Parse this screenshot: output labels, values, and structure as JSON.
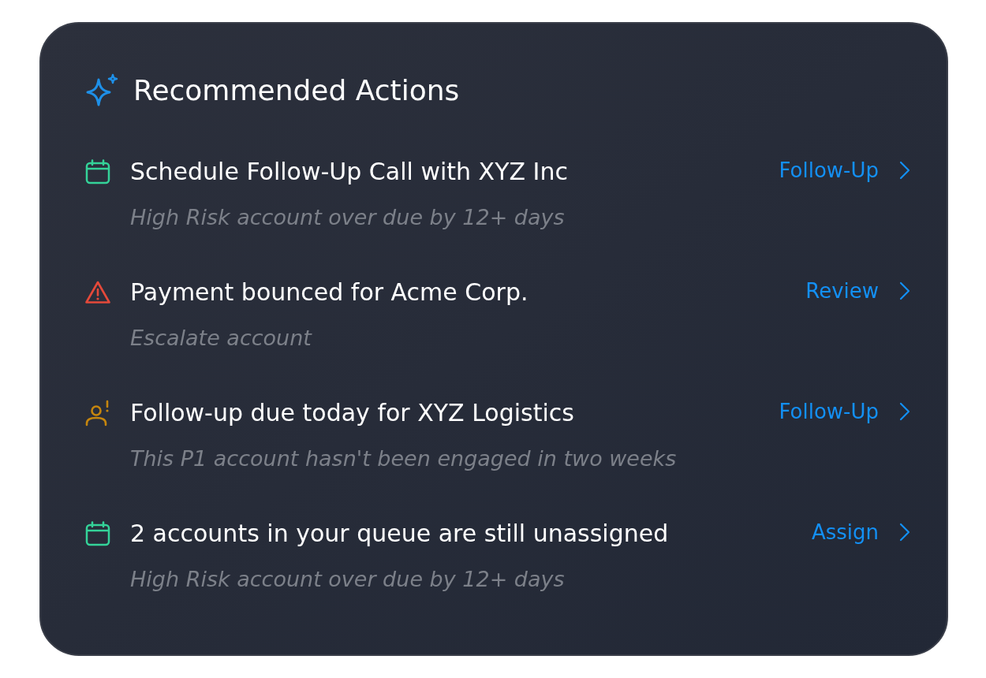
{
  "header": {
    "title": "Recommended Actions"
  },
  "actions": [
    {
      "kind": "schedule",
      "color": "#34d399",
      "title": "Schedule Follow-Up Call with XYZ Inc",
      "description": "High Risk account over due by 12+ days",
      "action": "Follow-Up"
    },
    {
      "kind": "alert",
      "color": "#e5493a",
      "title": "Payment bounced for Acme Corp.",
      "description": "Escalate account",
      "action": "Review"
    },
    {
      "kind": "contact",
      "color": "#c6860e",
      "title": "Follow-up due today for XYZ Logistics",
      "description": "This P1 account hasn't been engaged in two weeks",
      "action": "Follow-Up"
    },
    {
      "kind": "schedule",
      "color": "#34d399",
      "title": "2 accounts in your queue are still unassigned",
      "description": "High Risk account over due by 12+ days",
      "action": "Assign"
    }
  ]
}
